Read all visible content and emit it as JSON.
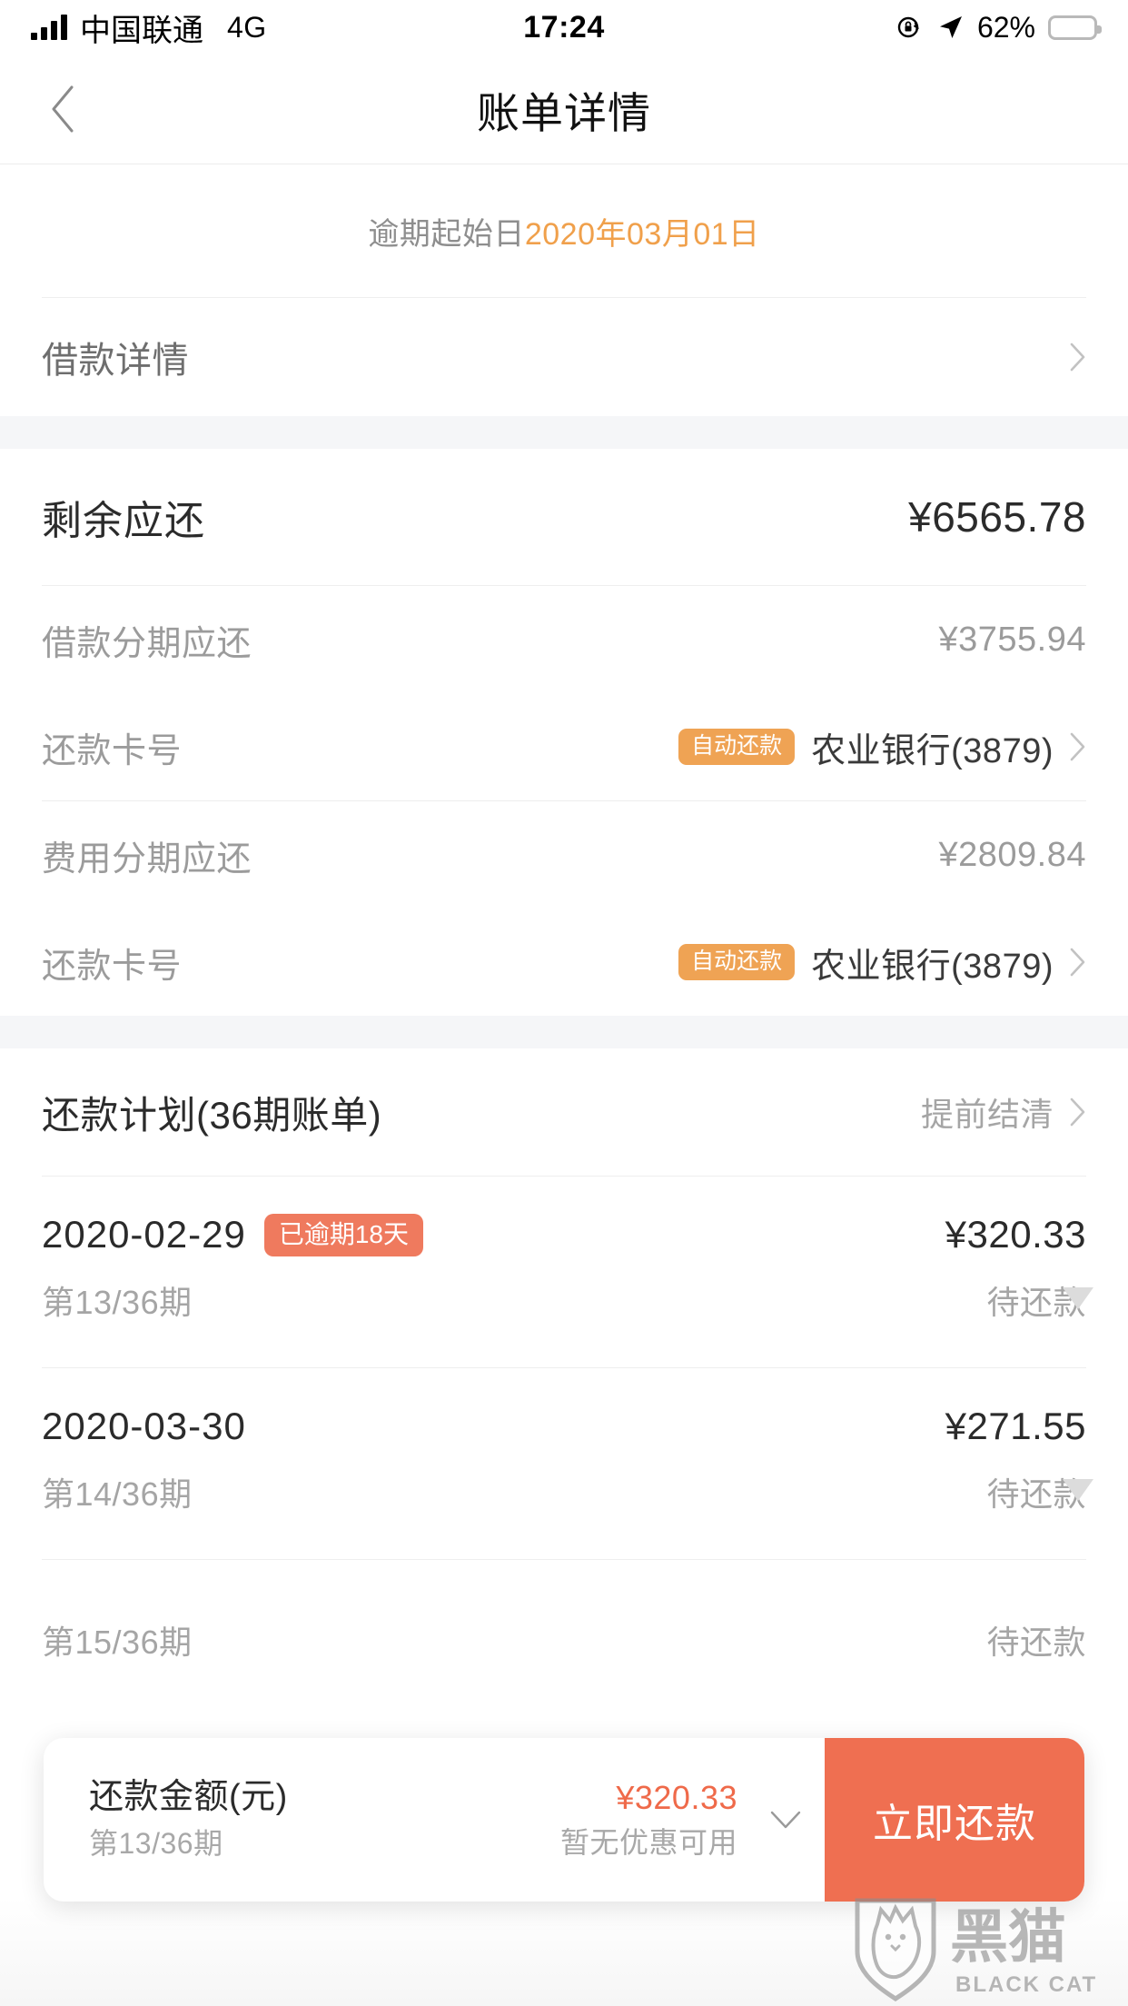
{
  "status_bar": {
    "carrier": "中国联通",
    "network": "4G",
    "time": "17:24",
    "battery_percent": "62%",
    "battery_level": 62,
    "icons": [
      "signal-bars-icon",
      "rotation-lock-icon",
      "location-arrow-icon",
      "battery-icon"
    ]
  },
  "nav": {
    "back_icon": "chevron-left-icon",
    "title": "账单详情"
  },
  "overdue_banner": {
    "label": "逾期起始日",
    "date": "2020年03月01日",
    "date_color": "#f0a04b"
  },
  "loan_detail": {
    "label": "借款详情",
    "chevron": "chevron-right-icon"
  },
  "summary": {
    "remaining": {
      "label": "剩余应还",
      "amount": "¥6565.78"
    },
    "groups": [
      {
        "amount_label": "借款分期应还",
        "amount": "¥3755.94",
        "card_label": "还款卡号",
        "badge": "自动还款",
        "card_name": "农业银行(3879)",
        "chevron": "chevron-right-icon"
      },
      {
        "amount_label": "费用分期应还",
        "amount": "¥2809.84",
        "card_label": "还款卡号",
        "badge": "自动还款",
        "card_name": "农业银行(3879)",
        "chevron": "chevron-right-icon"
      }
    ]
  },
  "plan": {
    "title": "还款计划(36期账单)",
    "action": "提前结清",
    "chevron": "chevron-right-icon",
    "installments": [
      {
        "date": "2020-02-29",
        "badge": "已逾期18天",
        "amount": "¥320.33",
        "period": "第13/36期",
        "status": "待还款",
        "expand_icon": "triangle-down-icon"
      },
      {
        "date": "2020-03-30",
        "badge": "",
        "amount": "¥271.55",
        "period": "第14/36期",
        "status": "待还款",
        "expand_icon": "triangle-down-icon"
      },
      {
        "date": "",
        "badge": "",
        "amount": "",
        "period": "第15/36期",
        "status": "待还款",
        "expand_icon": ""
      }
    ]
  },
  "bottom_bar": {
    "amount_title": "还款金额(元)",
    "amount_period": "第13/36期",
    "price": "¥320.33",
    "coupon": "暂无优惠可用",
    "expand_icon": "chevron-down-icon",
    "pay_button": "立即还款",
    "price_color": "#ef6a4a",
    "button_color": "#ef6f51"
  },
  "watermark": {
    "text_cn": "黑猫",
    "text_en": "BLACK CAT"
  },
  "colors": {
    "accent_orange": "#efa354",
    "accent_red": "#ef7a5e",
    "button_red": "#ef6f51",
    "date_orange": "#f0a04b",
    "page_bg": "#f5f6f8"
  }
}
